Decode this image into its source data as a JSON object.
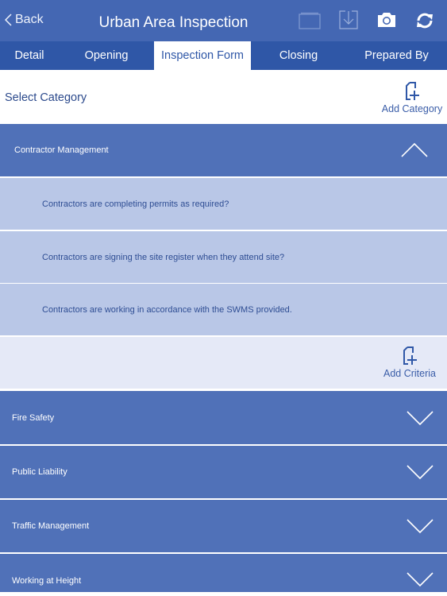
{
  "header": {
    "back_label": "Back",
    "title": "Urban Area Inspection",
    "icons": [
      "folder-icon",
      "download-icon",
      "camera-icon",
      "sync-icon"
    ]
  },
  "tabs": [
    {
      "label": "Detail",
      "active": false
    },
    {
      "label": "Opening",
      "active": false
    },
    {
      "label": "Inspection Form",
      "active": true
    },
    {
      "label": "Closing",
      "active": false
    },
    {
      "label": "Prepared By",
      "active": false
    }
  ],
  "select_category": {
    "label": "Select Category",
    "add_label": "Add Category"
  },
  "categories": [
    {
      "name": "Contractor Management",
      "expanded": true,
      "criteria": [
        "Contractors are completing permits as required?",
        "Contractors are signing the site register when they attend site?",
        "Contractors are working in accordance with the SWMS provided."
      ],
      "add_label": "Add Criteria"
    },
    {
      "name": "Fire Safety",
      "expanded": false
    },
    {
      "name": "Public Liability",
      "expanded": false
    },
    {
      "name": "Traffic Management",
      "expanded": false
    },
    {
      "name": "Working at Height",
      "expanded": false
    }
  ],
  "colors": {
    "header": "#4467b3",
    "tab_bar": "#2f57a7",
    "category_row": "#5071b8",
    "criteria_row": "#b9c7e7",
    "add_row": "#e5e9f7"
  }
}
